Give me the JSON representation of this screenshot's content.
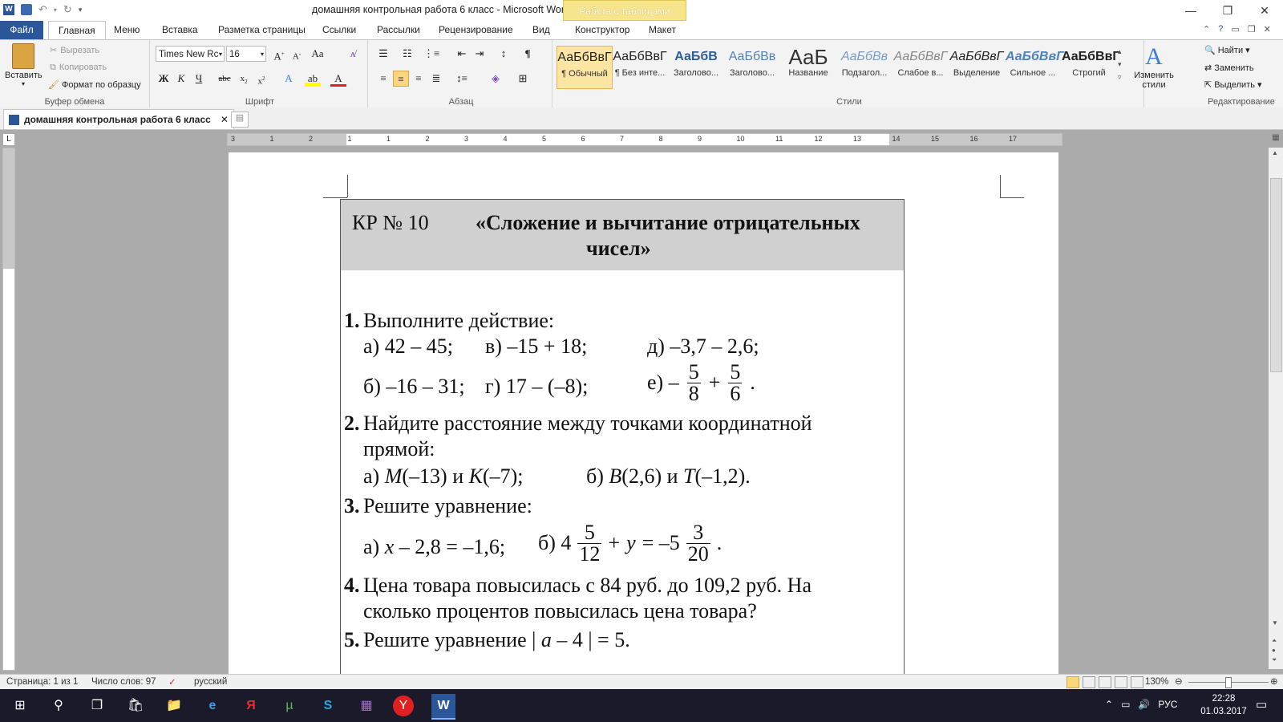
{
  "window": {
    "title": "домашняя контрольная работа 6 класс  -  Microsoft Word",
    "context_tab": "Работа с таблицами"
  },
  "menu_tabs": [
    "Файл",
    "Главная",
    "Меню",
    "Вставка",
    "Разметка страницы",
    "Ссылки",
    "Рассылки",
    "Рецензирование",
    "Вид",
    "Конструктор",
    "Макет"
  ],
  "ribbon": {
    "clipboard": {
      "paste": "Вставить",
      "cut": "Вырезать",
      "copy": "Копировать",
      "format_painter": "Формат по образцу",
      "label": "Буфер обмена"
    },
    "font": {
      "name": "Times New Rc",
      "size": "16",
      "label": "Шрифт"
    },
    "paragraph": {
      "label": "Абзац"
    },
    "styles": {
      "label": "Стили",
      "items": [
        {
          "sample": "АаБбВвГ",
          "name": "¶ Обычный"
        },
        {
          "sample": "АаБбВвГ",
          "name": "¶ Без инте..."
        },
        {
          "sample": "АаБбВ",
          "name": "Заголово..."
        },
        {
          "sample": "АаБбВв",
          "name": "Заголово..."
        },
        {
          "sample": "АаБ",
          "name": "Название"
        },
        {
          "sample": "АаБбВв",
          "name": "Подзагол..."
        },
        {
          "sample": "АаБбВвГ",
          "name": "Слабое в..."
        },
        {
          "sample": "АаБбВвГ",
          "name": "Выделение"
        },
        {
          "sample": "АаБбВвГ",
          "name": "Сильное ..."
        },
        {
          "sample": "АаБбВвГ",
          "name": "Строгий"
        }
      ],
      "change": "Изменить стили"
    },
    "editing": {
      "find": "Найти",
      "replace": "Заменить",
      "select": "Выделить",
      "label": "Редактирование"
    }
  },
  "doc_tab": "домашняя контрольная работа 6 класс",
  "ruler_numbers": [
    "3",
    "1",
    "2",
    "1",
    "1",
    "2",
    "3",
    "4",
    "5",
    "6",
    "7",
    "8",
    "9",
    "10",
    "11",
    "12",
    "13",
    "14",
    "15",
    "16",
    "17"
  ],
  "document": {
    "header_left": "КР № 10",
    "header_title_1": "«Сложение и вычитание отрицательных",
    "header_title_2": "чисел»",
    "q1": {
      "num": "1.",
      "text": "Выполните действие:",
      "a": "а)  42 – 45;",
      "v": "в)  –15 + 18;",
      "d": "д)  –3,7 – 2,6;",
      "b": "б)  –16 – 31;",
      "g": "г)  17 – (–8);",
      "e_prefix": "е)  –",
      "e_n1": "5",
      "e_d1": "8",
      "e_plus": "+",
      "e_n2": "5",
      "e_d2": "6",
      "e_end": "."
    },
    "q2": {
      "num": "2.",
      "text1": "Найдите расстояние между точками координатной",
      "text2": "прямой:",
      "a_pre": "а) ",
      "a_m": "M",
      "a_mid": "(–13)  и  ",
      "a_k": "K",
      "a_end": "(–7);",
      "b_pre": "б) ",
      "b_b": "B",
      "b_mid": "(2,6)  и  ",
      "b_t": "T",
      "b_end": "(–1,2)."
    },
    "q3": {
      "num": "3.",
      "text": "Решите уравнение:",
      "a_pre": "а) ",
      "a_x": "x",
      "a_rest": "– 2,8 = –1,6;",
      "b_pre": "б) 4",
      "b_n1": "5",
      "b_d1": "12",
      "b_plus": "+",
      "b_y": "y",
      "b_eq": "= –5",
      "b_n2": "3",
      "b_d2": "20",
      "b_end": "."
    },
    "q4": {
      "num": "4.",
      "text1": "Цена товара повысилась с 84 руб. до 109,2 руб. На",
      "text2": "сколько процентов повысилась цена товара?"
    },
    "q5": {
      "num": "5.",
      "pre": "Решите уравнение | ",
      "var": "a",
      "post": "– 4 | = 5."
    }
  },
  "status": {
    "page": "Страница: 1 из 1",
    "words": "Число слов: 97",
    "lang": "русский",
    "zoom": "130%"
  },
  "taskbar": {
    "lang": "РУС",
    "time": "22:28",
    "date": "01.03.2017"
  }
}
